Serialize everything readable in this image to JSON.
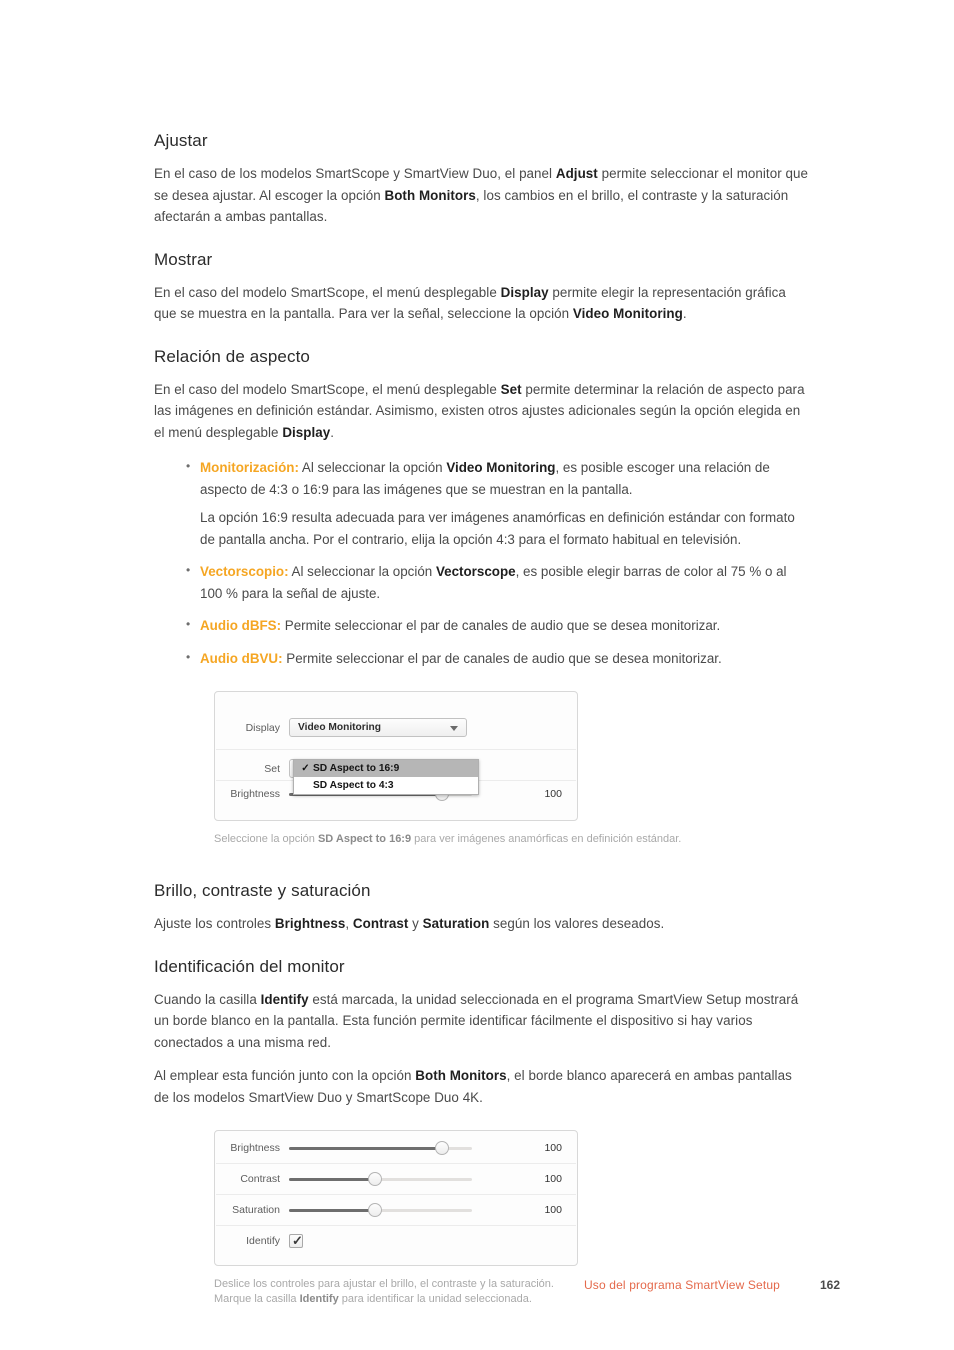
{
  "accent_color": "#f5a623",
  "footer_color": "#e4694b",
  "sections": [
    {
      "heading": "Ajustar",
      "paragraphs": [
        [
          {
            "t": "En el caso de los modelos SmartScope y SmartView Duo, el panel "
          },
          {
            "t": "Adjust",
            "b": true
          },
          {
            "t": " permite seleccionar el monitor que se desea ajustar. Al escoger la opción "
          },
          {
            "t": "Both Monitors",
            "b": true
          },
          {
            "t": ", los cambios en el brillo, el contraste y la saturación afectarán a ambas pantallas."
          }
        ]
      ]
    },
    {
      "heading": "Mostrar",
      "paragraphs": [
        [
          {
            "t": "En el caso del modelo SmartScope, el menú desplegable "
          },
          {
            "t": "Display",
            "b": true
          },
          {
            "t": " permite elegir la representación gráfica que se muestra en la pantalla. Para ver la señal, seleccione la opción "
          },
          {
            "t": "Video Monitoring",
            "b": true
          },
          {
            "t": "."
          }
        ]
      ]
    },
    {
      "heading": "Relación de aspecto",
      "paragraphs": [
        [
          {
            "t": "En el caso del modelo SmartScope, el menú desplegable "
          },
          {
            "t": "Set",
            "b": true
          },
          {
            "t": " permite determinar la relación de aspecto para las imágenes en definición estándar. Asimismo, existen otros ajustes adicionales según la opción elegida en el menú desplegable "
          },
          {
            "t": "Display",
            "b": true
          },
          {
            "t": "."
          }
        ]
      ]
    }
  ],
  "bullets": [
    {
      "term": "Monitorización:",
      "lines": [
        [
          {
            "t": " Al seleccionar la opción "
          },
          {
            "t": "Video Monitoring",
            "b": true
          },
          {
            "t": ", es posible escoger una relación de aspecto de 4:3 o 16:9 para las imágenes que se muestran en la pantalla."
          }
        ]
      ],
      "sub": "La opción 16:9 resulta adecuada para ver imágenes anamórficas en definición estándar con formato de pantalla ancha. Por el contrario, elija la opción 4:3 para el formato habitual en televisión."
    },
    {
      "term": "Vectorscopio:",
      "lines": [
        [
          {
            "t": " Al seleccionar la opción "
          },
          {
            "t": "Vectorscope",
            "b": true
          },
          {
            "t": ", es posible elegir barras de color al 75 % o al 100 % para la señal de ajuste."
          }
        ]
      ]
    },
    {
      "term": "Audio dBFS:",
      "lines": [
        [
          {
            "t": " Permite seleccionar el par de canales de audio que se desea monitorizar."
          }
        ]
      ]
    },
    {
      "term": "Audio dBVU:",
      "lines": [
        [
          {
            "t": " Permite seleccionar el par de canales de audio que se desea monitorizar."
          }
        ]
      ]
    }
  ],
  "figure_display": {
    "display_label": "Display",
    "display_value": "Video Monitoring",
    "set_label": "Set",
    "brightness_label": "Brightness",
    "brightness_value": "100",
    "dropdown_options": [
      {
        "label": "SD Aspect to 16:9",
        "checked": true
      },
      {
        "label": "SD Aspect to 4:3",
        "checked": false
      }
    ],
    "caption": [
      {
        "t": "Seleccione la opción "
      },
      {
        "t": "SD Aspect to 16:9",
        "b": true
      },
      {
        "t": " para ver imágenes anamórficas en definición estándar."
      }
    ]
  },
  "sections2": [
    {
      "heading": "Brillo, contraste y saturación",
      "paragraphs": [
        [
          {
            "t": "Ajuste los controles "
          },
          {
            "t": "Brightness",
            "b": true
          },
          {
            "t": ", "
          },
          {
            "t": "Contrast",
            "b": true
          },
          {
            "t": " y "
          },
          {
            "t": "Saturation",
            "b": true
          },
          {
            "t": " según los valores deseados."
          }
        ]
      ]
    },
    {
      "heading": "Identificación del monitor",
      "paragraphs": [
        [
          {
            "t": "Cuando la casilla "
          },
          {
            "t": "Identify",
            "b": true
          },
          {
            "t": " está marcada, la unidad seleccionada en el programa SmartView Setup mostrará un borde blanco en la pantalla. Esta función permite identificar fácilmente el dispositivo si hay varios conectados a una misma red."
          }
        ],
        [
          {
            "t": "Al emplear esta función junto con la opción "
          },
          {
            "t": "Both Monitors",
            "b": true
          },
          {
            "t": ", el borde blanco aparecerá en ambas pantallas de los modelos SmartView Duo y SmartScope Duo 4K."
          }
        ]
      ]
    }
  ],
  "figure_sliders": {
    "rows": [
      {
        "label": "Brightness",
        "value": "100",
        "knob_pct": 80
      },
      {
        "label": "Contrast",
        "value": "100",
        "knob_pct": 45
      },
      {
        "label": "Saturation",
        "value": "100",
        "knob_pct": 45
      }
    ],
    "identify_label": "Identify",
    "identify_checked": true,
    "caption": [
      {
        "t": "Deslice los controles para ajustar el brillo, el contraste y la saturación."
      },
      {
        "t": "\n"
      },
      {
        "t": "Marque la casilla "
      },
      {
        "t": "Identify",
        "b": true
      },
      {
        "t": " para identificar la unidad seleccionada."
      }
    ]
  },
  "footer": {
    "title": "Uso del programa SmartView Setup",
    "page": "162"
  }
}
